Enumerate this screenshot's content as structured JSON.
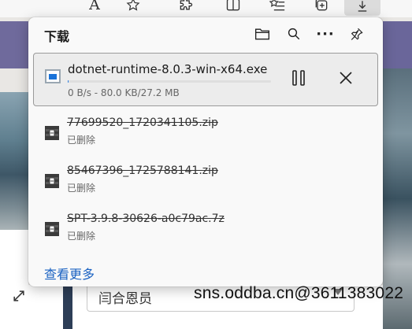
{
  "toolbar": {
    "icons": [
      "read-aloud-icon",
      "favorite-star-icon",
      "extensions-icon",
      "split-screen-icon",
      "favorites-icon",
      "collections-icon",
      "downloads-icon"
    ],
    "read_aloud_glyph": "A",
    "colors": {
      "active_button_bg": "#dcdcdc"
    }
  },
  "downloads": {
    "title": "下载",
    "header_icons": [
      "folder-icon",
      "search-icon",
      "more-icon",
      "pin-icon"
    ],
    "more_glyph": "···",
    "active": {
      "file_name": "dotnet-runtime-8.0.3-win-x64.exe",
      "status": "0 B/s - 80.0 KB/27.2 MB",
      "progress_fraction": 0.003,
      "icon": "exe-file-icon"
    },
    "items": [
      {
        "file_name": "77699520_1720341105.zip",
        "status": "已删除",
        "icon": "archive-file-icon"
      },
      {
        "file_name": "85467396_1725788141.zip",
        "status": "已删除",
        "icon": "archive-file-icon"
      },
      {
        "file_name": "SPT-3.9.8-30626-a0c79ac.7z",
        "status": "已删除",
        "icon": "archive-file-icon"
      }
    ],
    "see_more": "查看更多",
    "colors": {
      "link": "#1a62c2",
      "progress": "#2a7de1"
    }
  },
  "background_page": {
    "select_value": "闫合恩员"
  },
  "watermark": "sns.oddba.cn@3611383022"
}
